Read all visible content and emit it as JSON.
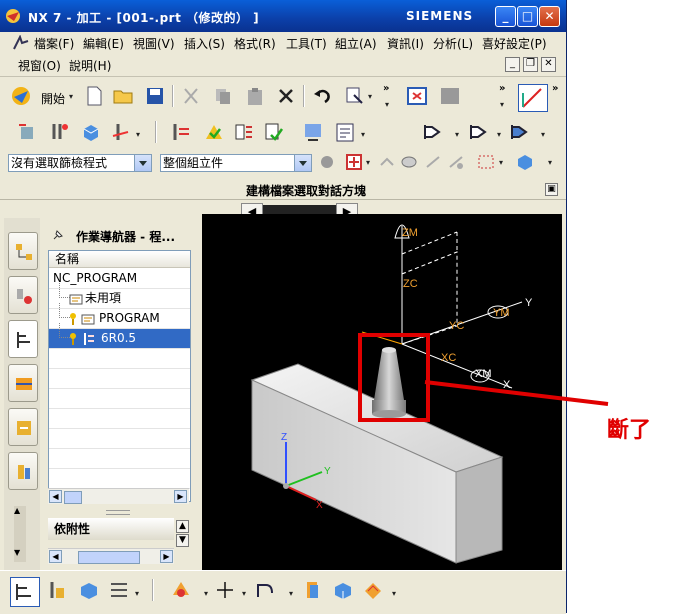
{
  "window": {
    "title": "NX 7 - 加工 - [001-.prt （修改的） ]",
    "brand": "SIEMENS",
    "minimize_glyph": "_",
    "maximize_glyph": "□",
    "close_glyph": "✕"
  },
  "menu": {
    "row1": [
      "檔案(F)",
      "編輯(E)",
      "視圖(V)",
      "插入(S)",
      "格式(R)",
      "工具(T)",
      "組立(A)",
      "資訊(I)",
      "分析(L)",
      "喜好設定(P)"
    ],
    "row2": [
      "視窗(O)",
      "說明(H)"
    ]
  },
  "toolbar": {
    "start_label": "開始",
    "start_drop": "▾"
  },
  "filters": {
    "selection_filter": "沒有選取篩檢程式",
    "assembly_scope": "整個組立件"
  },
  "dialog_bar": {
    "title": "建構檔案選取對話方塊",
    "left_arrow": "◀",
    "right_arrow": "▶"
  },
  "navigator": {
    "title": "作業導航器 - 程...",
    "column_header": "名稱",
    "rows": [
      {
        "label": "NC_PROGRAM",
        "selected": false
      },
      {
        "label": "未用項",
        "selected": false
      },
      {
        "label": "PROGRAM",
        "selected": false
      },
      {
        "label": "6R0.5",
        "selected": true
      }
    ],
    "dependency_panel": "依附性"
  },
  "viewport": {
    "axis_labels": {
      "zm": "ZM",
      "zc": "ZC",
      "yc": "YC",
      "ym": "YM",
      "y_top": "Y",
      "xc": "XC",
      "xm": "XM",
      "x_top": "X",
      "z_abs": "Z",
      "y_abs": "Y",
      "x_abs": "X"
    },
    "background": "#000000",
    "highlight_color": "#e00000"
  },
  "annotation": {
    "text": "斷了",
    "color": "#e00000"
  }
}
